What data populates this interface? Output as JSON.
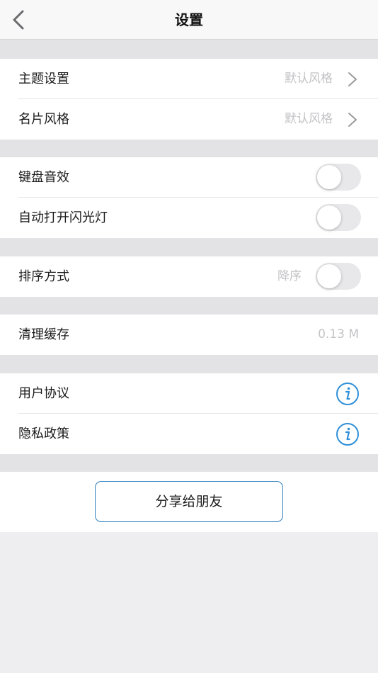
{
  "navbar": {
    "title": "设置",
    "back_icon": "chevron-left-icon"
  },
  "sections": {
    "theme": {
      "label": "主题设置",
      "value": "默认风格",
      "icon": "chevron-right-icon"
    },
    "card_style": {
      "label": "名片风格",
      "value": "默认风格",
      "icon": "chevron-right-icon"
    },
    "keyboard_sound": {
      "label": "键盘音效",
      "toggle_on": false
    },
    "auto_flash": {
      "label": "自动打开闪光灯",
      "toggle_on": false
    },
    "sort": {
      "label": "排序方式",
      "value": "降序",
      "toggle_on": false
    },
    "clear_cache": {
      "label": "清理缓存",
      "value": "0.13 M"
    },
    "user_agreement": {
      "label": "用户协议",
      "icon": "info-icon"
    },
    "privacy_policy": {
      "label": "隐私政策",
      "icon": "info-icon"
    }
  },
  "share": {
    "label": "分享给朋友"
  },
  "colors": {
    "accent": "#2f7fbf",
    "background": "#eeeef1",
    "section_gap": "#e3e3e5",
    "secondary_text": "#c3c3c6"
  }
}
